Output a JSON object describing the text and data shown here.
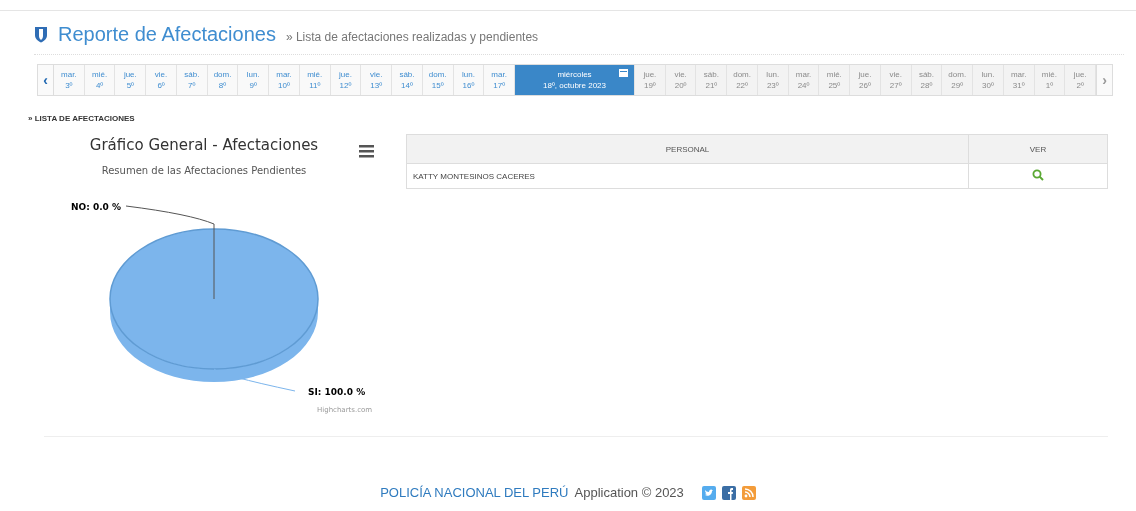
{
  "header": {
    "title": "Reporte de Afectaciones",
    "subtitle": "» Lista de afectaciones realizadas y pendientes"
  },
  "calendar": {
    "prev": "‹",
    "next": "›",
    "days": [
      {
        "day": "mar.",
        "date": "3º",
        "selected": false,
        "disabled": false
      },
      {
        "day": "mié.",
        "date": "4º",
        "selected": false,
        "disabled": false
      },
      {
        "day": "jue.",
        "date": "5º",
        "selected": false,
        "disabled": false
      },
      {
        "day": "vie.",
        "date": "6º",
        "selected": false,
        "disabled": false
      },
      {
        "day": "sáb.",
        "date": "7º",
        "selected": false,
        "disabled": false
      },
      {
        "day": "dom.",
        "date": "8º",
        "selected": false,
        "disabled": false
      },
      {
        "day": "lun.",
        "date": "9º",
        "selected": false,
        "disabled": false
      },
      {
        "day": "mar.",
        "date": "10º",
        "selected": false,
        "disabled": false
      },
      {
        "day": "mié.",
        "date": "11º",
        "selected": false,
        "disabled": false
      },
      {
        "day": "jue.",
        "date": "12º",
        "selected": false,
        "disabled": false
      },
      {
        "day": "vie.",
        "date": "13º",
        "selected": false,
        "disabled": false
      },
      {
        "day": "sáb.",
        "date": "14º",
        "selected": false,
        "disabled": false
      },
      {
        "day": "dom.",
        "date": "15º",
        "selected": false,
        "disabled": false
      },
      {
        "day": "lun.",
        "date": "16º",
        "selected": false,
        "disabled": false
      },
      {
        "day": "mar.",
        "date": "17º",
        "selected": false,
        "disabled": false
      },
      {
        "day": "miércoles",
        "date": "18º, octubre 2023",
        "selected": true,
        "disabled": false
      },
      {
        "day": "jue.",
        "date": "19º",
        "selected": false,
        "disabled": true
      },
      {
        "day": "vie.",
        "date": "20º",
        "selected": false,
        "disabled": true
      },
      {
        "day": "sáb.",
        "date": "21º",
        "selected": false,
        "disabled": true
      },
      {
        "day": "dom.",
        "date": "22º",
        "selected": false,
        "disabled": true
      },
      {
        "day": "lun.",
        "date": "23º",
        "selected": false,
        "disabled": true
      },
      {
        "day": "mar.",
        "date": "24º",
        "selected": false,
        "disabled": true
      },
      {
        "day": "mié.",
        "date": "25º",
        "selected": false,
        "disabled": true
      },
      {
        "day": "jue.",
        "date": "26º",
        "selected": false,
        "disabled": true
      },
      {
        "day": "vie.",
        "date": "27º",
        "selected": false,
        "disabled": true
      },
      {
        "day": "sáb.",
        "date": "28º",
        "selected": false,
        "disabled": true
      },
      {
        "day": "dom.",
        "date": "29º",
        "selected": false,
        "disabled": true
      },
      {
        "day": "lun.",
        "date": "30º",
        "selected": false,
        "disabled": true
      },
      {
        "day": "mar.",
        "date": "31º",
        "selected": false,
        "disabled": true
      },
      {
        "day": "mié.",
        "date": "1º",
        "selected": false,
        "disabled": true
      },
      {
        "day": "jue.",
        "date": "2º",
        "selected": false,
        "disabled": true
      }
    ]
  },
  "section_title": "» LISTA DE AFECTACIONES",
  "chart": {
    "credits": "Highcharts.com",
    "chart_data": {
      "type": "pie",
      "title": "Gráfico General - Afectaciones",
      "subtitle": "Resumen de las Afectaciones Pendientes",
      "categories": [
        "NO: 0.0 %",
        "SI: 100.0 %"
      ],
      "series": [
        {
          "color": "#7cb5ec",
          "values": [
            0,
            100
          ]
        }
      ]
    }
  },
  "table": {
    "columns": [
      "PERSONAL",
      "VER"
    ],
    "rows": [
      {
        "personal": "KATTY MONTESINOS CACERES"
      }
    ]
  },
  "footer": {
    "brand": "POLICÍA NACIONAL DEL PERÚ",
    "text": "Application © 2023"
  }
}
